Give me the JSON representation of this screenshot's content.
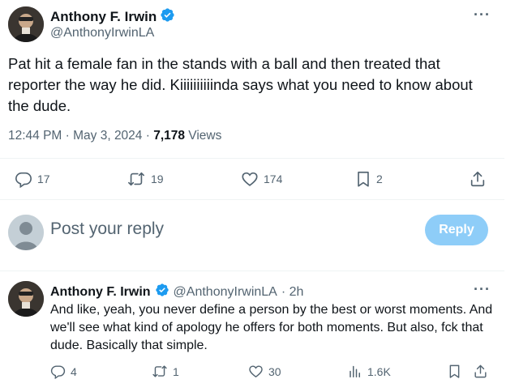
{
  "tweet": {
    "author_name": "Anthony F. Irwin",
    "author_handle": "@AnthonyIrwinLA",
    "more": "···",
    "text": "Pat hit a female fan in the stands with a ball and then treated that reporter the way he did. Kiiiiiiiiiinda says what you need to know about the dude.",
    "time": "12:44 PM · May 3, 2024 · ",
    "views_count": "7,178",
    "views_label": " Views",
    "actions": {
      "replies": "17",
      "retweets": "19",
      "likes": "174",
      "bookmarks": "2"
    }
  },
  "compose": {
    "placeholder": "Post your reply",
    "button_label": "Reply"
  },
  "reply": {
    "author_name": "Anthony F. Irwin",
    "author_handle": "@AnthonyIrwinLA",
    "sep_time": "· 2h",
    "more": "···",
    "text": "And like, yeah, you never define a person by the best or worst moments. And we'll see what kind of apology he offers for both moments. But also, fck that dude. Basically that simple.",
    "actions": {
      "replies": "4",
      "retweets": "1",
      "likes": "30",
      "views": "1.6K"
    }
  },
  "colors": {
    "verified": "#1d9bf0",
    "reply_button": "#8ecdf8",
    "muted": "#536471"
  }
}
